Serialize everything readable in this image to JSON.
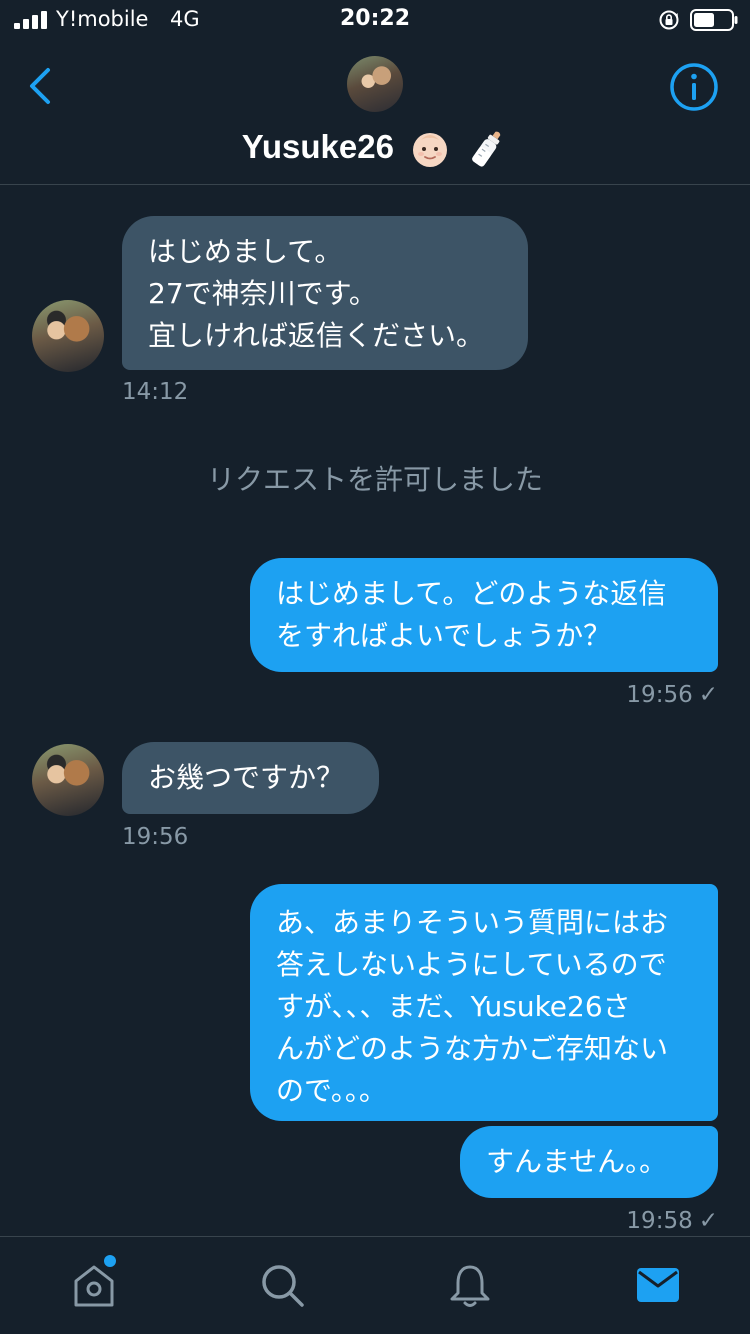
{
  "status_bar": {
    "carrier": "Y!mobile",
    "network": "4G",
    "time": "20:22"
  },
  "header": {
    "name": "Yusuke26",
    "emoji": [
      "baby-face",
      "baby-bottle"
    ],
    "avatar": "profile-photo",
    "back_icon": "chevron-left-icon",
    "info_icon": "info-icon"
  },
  "messages": [
    {
      "direction": "in",
      "lines": [
        "はじめまして。",
        "27で神奈川です。",
        "宜しければ返信ください。"
      ],
      "time": "14:12"
    },
    {
      "direction": "system",
      "text": "リクエストを許可しました"
    },
    {
      "direction": "out",
      "lines": [
        "はじめまして。どのような返信",
        "をすればよいでしょうか？"
      ],
      "time": "19:56",
      "check": "✓"
    },
    {
      "direction": "in",
      "lines": [
        "お幾つですか？"
      ],
      "time": "19:56"
    },
    {
      "direction": "out",
      "lines": [
        "あ、あまりそういう質問にはお",
        "答えしないようにしているので",
        "すが、、、まだ、Yusuke26さ",
        "んがどのような方かご存知ない",
        "ので。。。"
      ]
    },
    {
      "direction": "out",
      "lines": [
        "すんません。。"
      ],
      "time": "19:58",
      "check": "✓"
    }
  ],
  "tabbar": {
    "items": [
      "home-icon",
      "search-icon",
      "bell-icon",
      "mail-icon"
    ],
    "active": "mail-icon",
    "home_has_notification": true
  },
  "colors": {
    "background": "#15202b",
    "incoming_bubble": "#3d5466",
    "outgoing_bubble": "#1da1f2",
    "accent": "#1da1f2",
    "muted_text": "#8899a6"
  }
}
